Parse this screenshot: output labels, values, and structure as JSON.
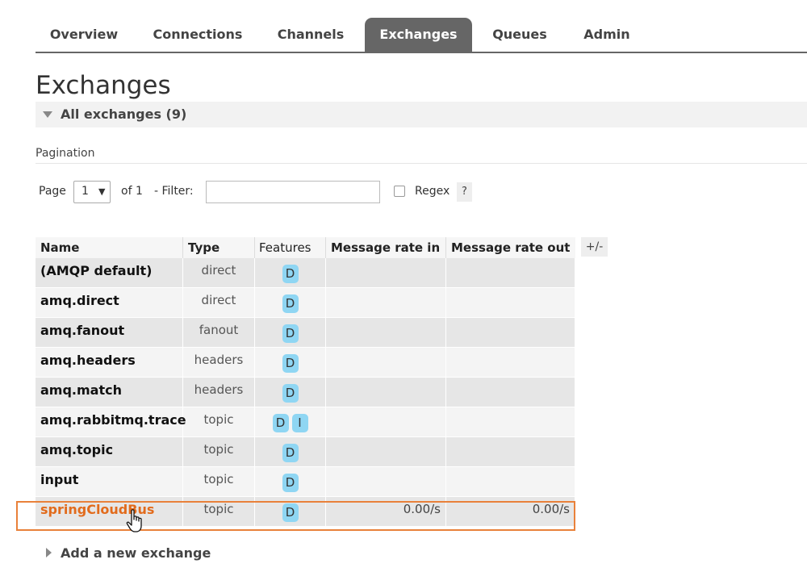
{
  "nav": {
    "tabs": [
      {
        "label": "Overview",
        "active": false
      },
      {
        "label": "Connections",
        "active": false
      },
      {
        "label": "Channels",
        "active": false
      },
      {
        "label": "Exchanges",
        "active": true
      },
      {
        "label": "Queues",
        "active": false
      },
      {
        "label": "Admin",
        "active": false
      }
    ]
  },
  "page": {
    "title": "Exchanges",
    "section_label": "All exchanges (9)"
  },
  "pagination": {
    "label": "Pagination",
    "page_label": "Page",
    "page_value": "1",
    "of_label": "of 1",
    "filter_label": "- Filter:",
    "filter_value": "",
    "regex_label": "Regex",
    "regex_checked": false,
    "help_label": "?"
  },
  "table": {
    "columns": [
      "Name",
      "Type",
      "Features",
      "Message rate in",
      "Message rate out"
    ],
    "column_toggle": "+/-",
    "rows": [
      {
        "name": "(AMQP default)",
        "type": "direct",
        "features": [
          "D"
        ],
        "rate_in": "",
        "rate_out": ""
      },
      {
        "name": "amq.direct",
        "type": "direct",
        "features": [
          "D"
        ],
        "rate_in": "",
        "rate_out": ""
      },
      {
        "name": "amq.fanout",
        "type": "fanout",
        "features": [
          "D"
        ],
        "rate_in": "",
        "rate_out": ""
      },
      {
        "name": "amq.headers",
        "type": "headers",
        "features": [
          "D"
        ],
        "rate_in": "",
        "rate_out": ""
      },
      {
        "name": "amq.match",
        "type": "headers",
        "features": [
          "D"
        ],
        "rate_in": "",
        "rate_out": ""
      },
      {
        "name": "amq.rabbitmq.trace",
        "type": "topic",
        "features": [
          "D",
          "I"
        ],
        "rate_in": "",
        "rate_out": ""
      },
      {
        "name": "amq.topic",
        "type": "topic",
        "features": [
          "D"
        ],
        "rate_in": "",
        "rate_out": ""
      },
      {
        "name": "input",
        "type": "topic",
        "features": [
          "D"
        ],
        "rate_in": "",
        "rate_out": ""
      },
      {
        "name": "springCloudBus",
        "type": "topic",
        "features": [
          "D"
        ],
        "rate_in": "0.00/s",
        "rate_out": "0.00/s",
        "highlighted": true
      }
    ]
  },
  "add_exchange": {
    "label": "Add a new exchange"
  },
  "colors": {
    "nav_active": "#666666",
    "feature_badge": "#8fd6f3",
    "highlight_border": "#e9813a",
    "link": "#e26b1c"
  },
  "icons": {
    "section_toggle": "triangle-down-icon",
    "add_toggle": "triangle-right-icon",
    "cursor": "hand-pointer-icon"
  }
}
